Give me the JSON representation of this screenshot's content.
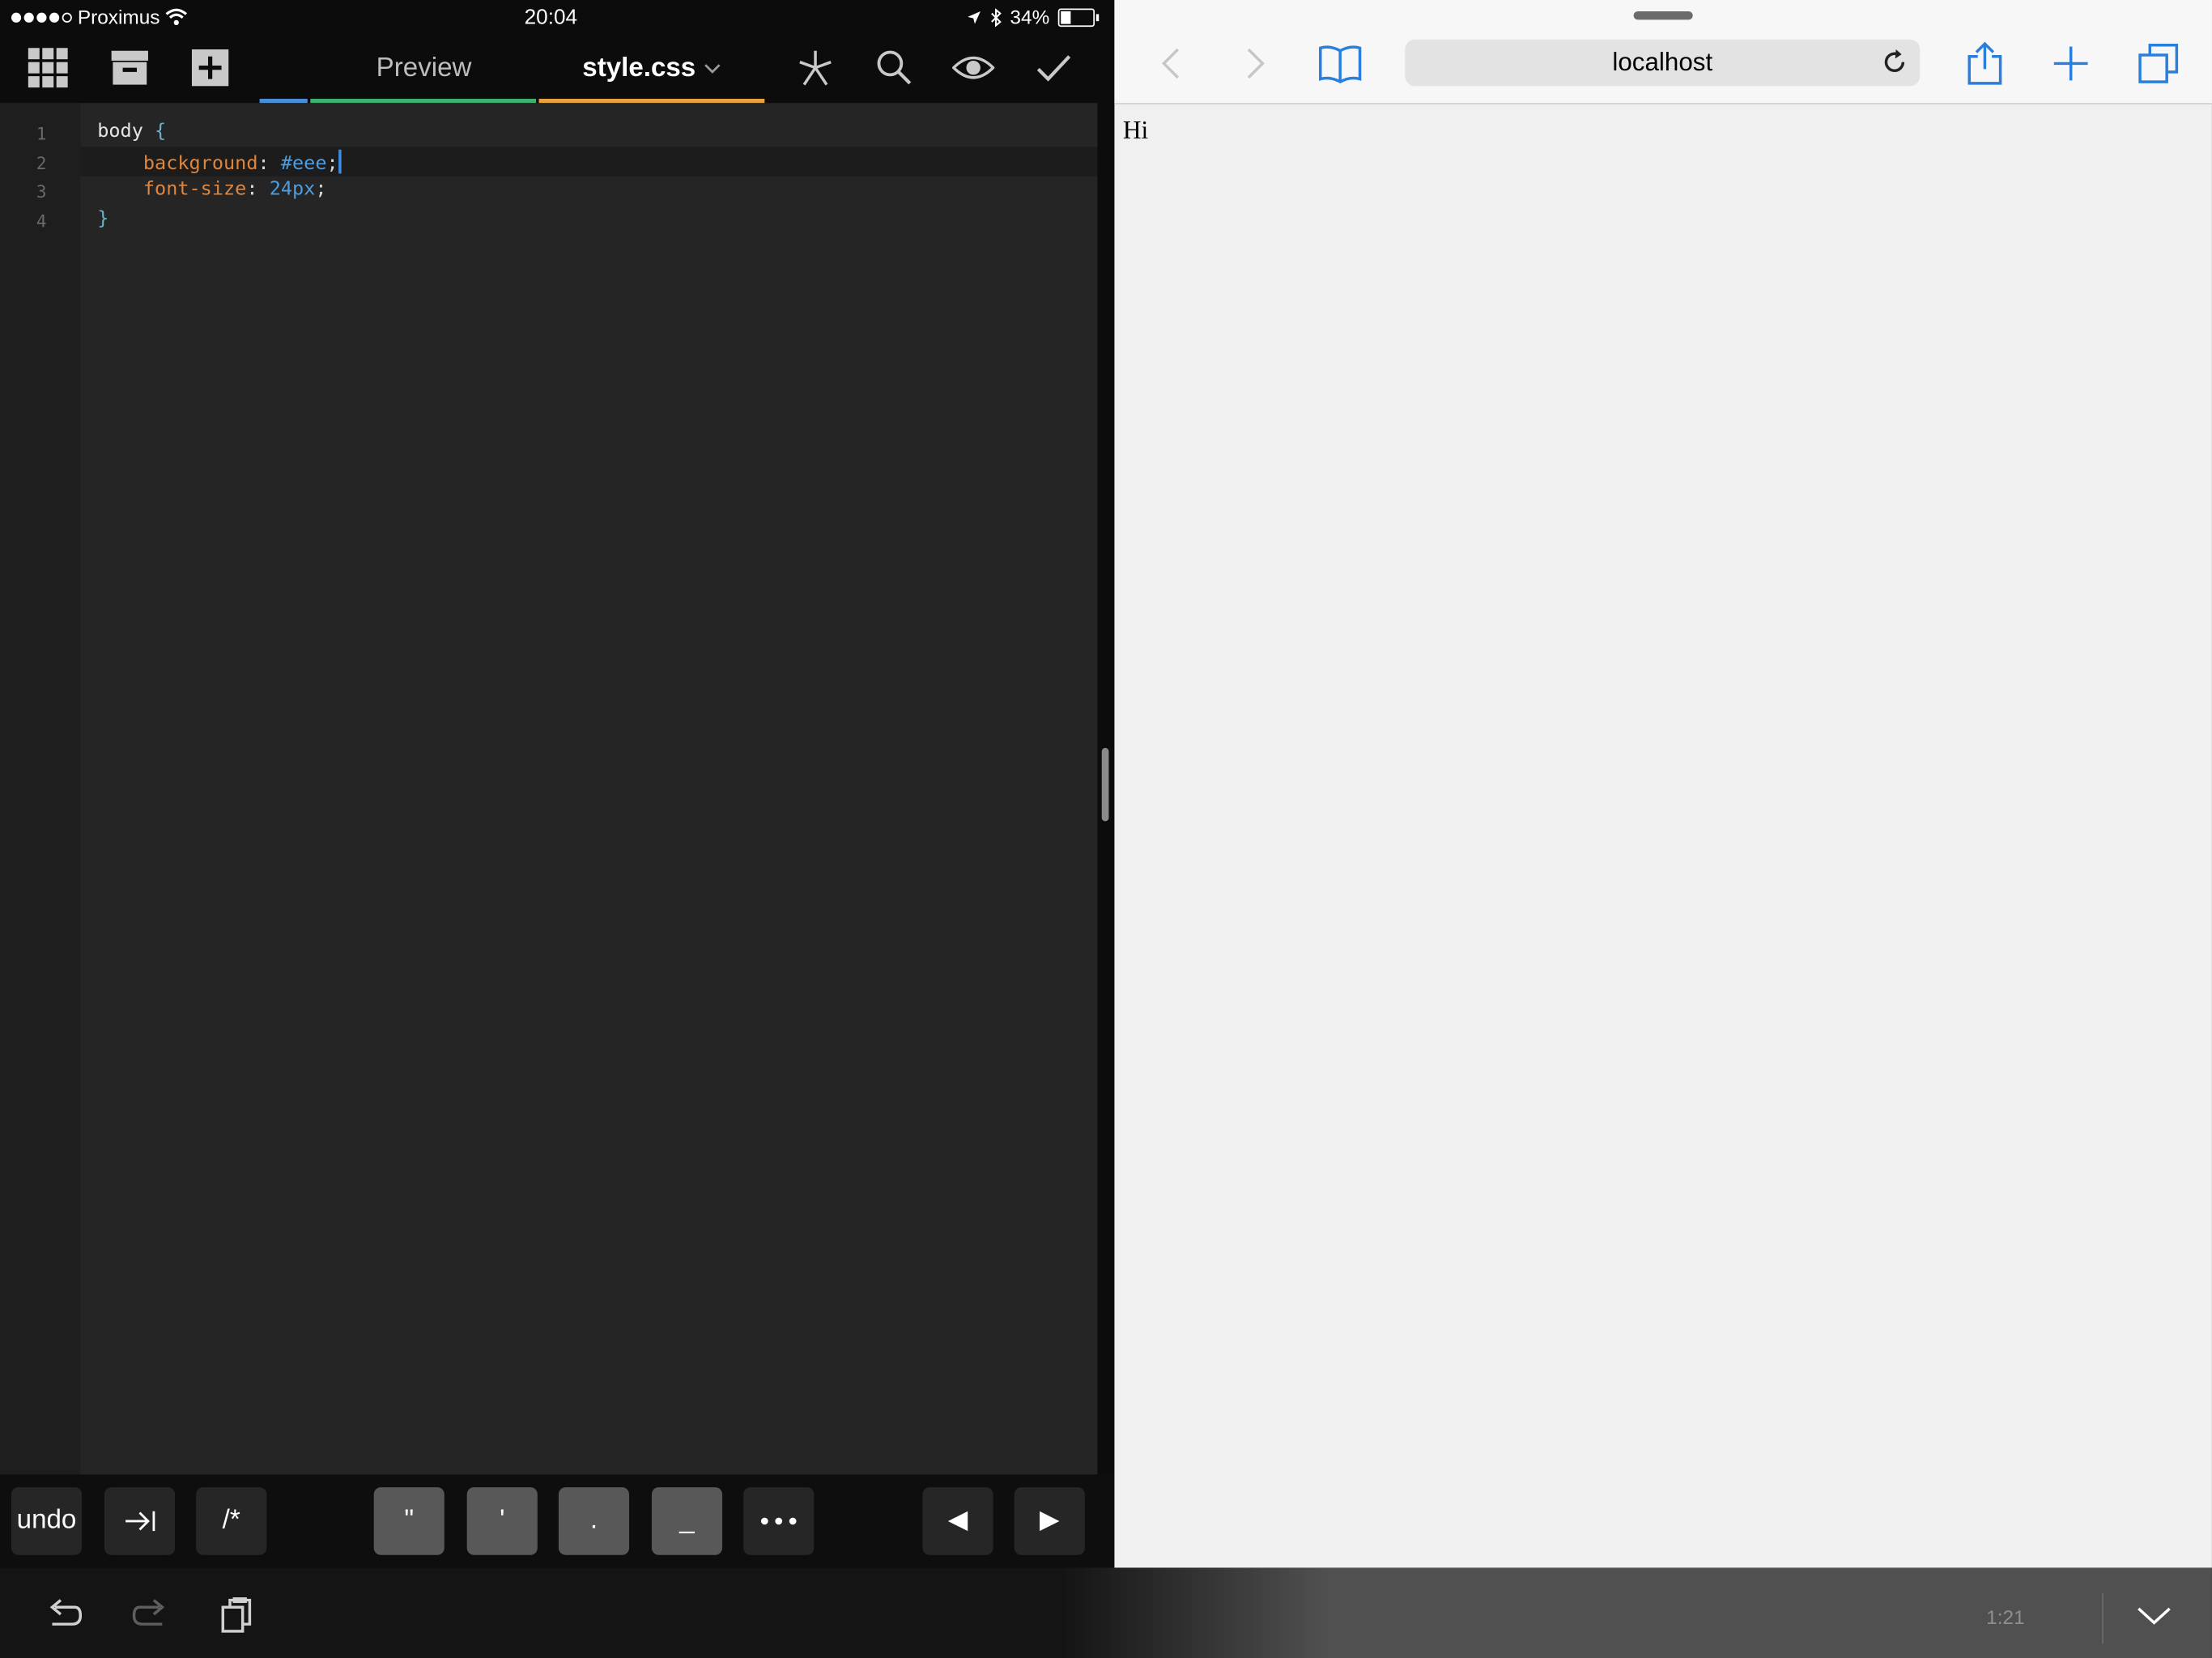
{
  "status": {
    "carrier": "Proximus",
    "time": "20:04",
    "battery_percent": "34%",
    "battery_level": 0.34
  },
  "editor": {
    "tabs": [
      {
        "label": "Preview",
        "underline_color": "#3cb371"
      },
      {
        "label": "style.css",
        "underline_color": "#e8a43a"
      }
    ],
    "first_tab_accent": "#4a90d9",
    "line_numbers": [
      "1",
      "2",
      "3",
      "4"
    ],
    "code": {
      "l1_selector": "body",
      "l1_brace": "{",
      "l2_prop": "background",
      "l2_colon": ":",
      "l2_value": "#eee",
      "l2_semi": ";",
      "l3_prop": "font-size",
      "l3_colon": ":",
      "l3_value": "24px",
      "l3_semi": ";",
      "l4_brace": "}"
    },
    "icons": [
      "grid-icon",
      "archive-icon",
      "add-file-icon",
      "asterisk-icon",
      "search-icon",
      "eye-icon",
      "checkmark-icon"
    ]
  },
  "keybar": {
    "undo": "undo",
    "comment": "/*",
    "double_quote": "\"",
    "single_quote": "'",
    "period": ".",
    "underscore": "_"
  },
  "bottombar": {
    "cursor_position": "1:21"
  },
  "browser": {
    "url": "localhost",
    "page_text": "Hi"
  }
}
